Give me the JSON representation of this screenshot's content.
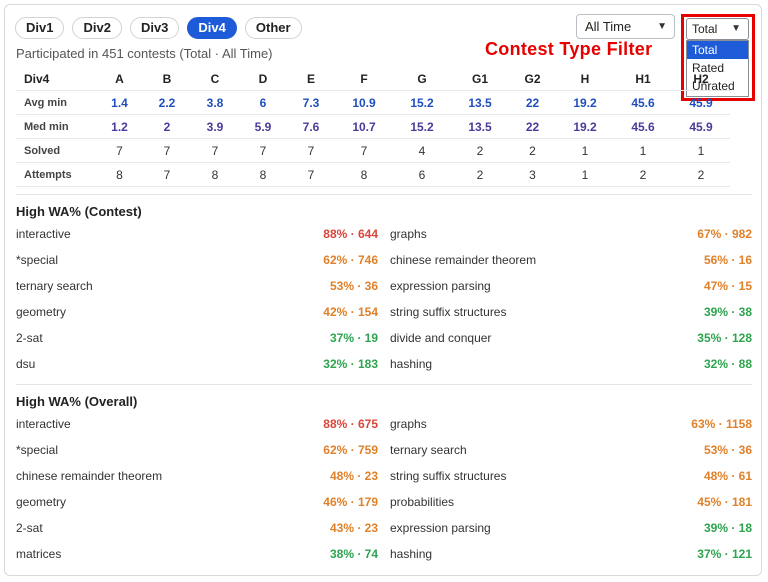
{
  "tabs": [
    "Div1",
    "Div2",
    "Div3",
    "Div4",
    "Other"
  ],
  "active_tab": "Div4",
  "subtitle": "Participated in 451 contests (Total · All Time)",
  "time_filter": {
    "value": "All Time"
  },
  "type_filter": {
    "value": "Total",
    "options": [
      "Total",
      "Rated",
      "Unrated"
    ],
    "selected": "Total"
  },
  "annotation": "Contest Type Filter",
  "stats_table": {
    "header": [
      "Div4",
      "A",
      "B",
      "C",
      "D",
      "E",
      "F",
      "G",
      "G1",
      "G2",
      "H",
      "H1",
      "H2"
    ],
    "rows": [
      {
        "label": "Avg min",
        "values": [
          "1.4",
          "2.2",
          "3.8",
          "6",
          "7.3",
          "10.9",
          "15.2",
          "13.5",
          "22",
          "19.2",
          "45.6",
          "45.9"
        ]
      },
      {
        "label": "Med min",
        "values": [
          "1.2",
          "2",
          "3.9",
          "5.9",
          "7.6",
          "10.7",
          "15.2",
          "13.5",
          "22",
          "19.2",
          "45.6",
          "45.9"
        ]
      },
      {
        "label": "Solved",
        "values": [
          "7",
          "7",
          "7",
          "7",
          "7",
          "7",
          "4",
          "2",
          "2",
          "1",
          "1",
          "1"
        ]
      },
      {
        "label": "Attempts",
        "values": [
          "8",
          "7",
          "8",
          "8",
          "7",
          "8",
          "6",
          "2",
          "3",
          "1",
          "2",
          "2"
        ]
      }
    ]
  },
  "wa_contest": {
    "title": "High WA% (Contest)",
    "items": [
      {
        "name": "interactive",
        "value": "88% · 644",
        "color": "#d9453a"
      },
      {
        "name": "graphs",
        "value": "67% · 982",
        "color": "#e0812a"
      },
      {
        "name": "*special",
        "value": "62% · 746",
        "color": "#e0812a"
      },
      {
        "name": "chinese remainder theorem",
        "value": "56% · 16",
        "color": "#e0812a"
      },
      {
        "name": "ternary search",
        "value": "53% · 36",
        "color": "#e0812a"
      },
      {
        "name": "expression parsing",
        "value": "47% · 15",
        "color": "#e0812a"
      },
      {
        "name": "geometry",
        "value": "42% · 154",
        "color": "#e0812a"
      },
      {
        "name": "string suffix structures",
        "value": "39% · 38",
        "color": "#2ea44f"
      },
      {
        "name": "2-sat",
        "value": "37% · 19",
        "color": "#2ea44f"
      },
      {
        "name": "divide and conquer",
        "value": "35% · 128",
        "color": "#2ea44f"
      },
      {
        "name": "dsu",
        "value": "32% · 183",
        "color": "#2ea44f"
      },
      {
        "name": "hashing",
        "value": "32% · 88",
        "color": "#2ea44f"
      }
    ]
  },
  "wa_overall": {
    "title": "High WA% (Overall)",
    "items": [
      {
        "name": "interactive",
        "value": "88% · 675",
        "color": "#d9453a"
      },
      {
        "name": "graphs",
        "value": "63% · 1158",
        "color": "#e0812a"
      },
      {
        "name": "*special",
        "value": "62% · 759",
        "color": "#e0812a"
      },
      {
        "name": "ternary search",
        "value": "53% · 36",
        "color": "#e0812a"
      },
      {
        "name": "chinese remainder theorem",
        "value": "48% · 23",
        "color": "#e0812a"
      },
      {
        "name": "string suffix structures",
        "value": "48% · 61",
        "color": "#e0812a"
      },
      {
        "name": "geometry",
        "value": "46% · 179",
        "color": "#e0812a"
      },
      {
        "name": "probabilities",
        "value": "45% · 181",
        "color": "#e0812a"
      },
      {
        "name": "2-sat",
        "value": "43% · 23",
        "color": "#e0812a"
      },
      {
        "name": "expression parsing",
        "value": "39% · 18",
        "color": "#2ea44f"
      },
      {
        "name": "matrices",
        "value": "38% · 74",
        "color": "#2ea44f"
      },
      {
        "name": "hashing",
        "value": "37% · 121",
        "color": "#2ea44f"
      }
    ]
  }
}
